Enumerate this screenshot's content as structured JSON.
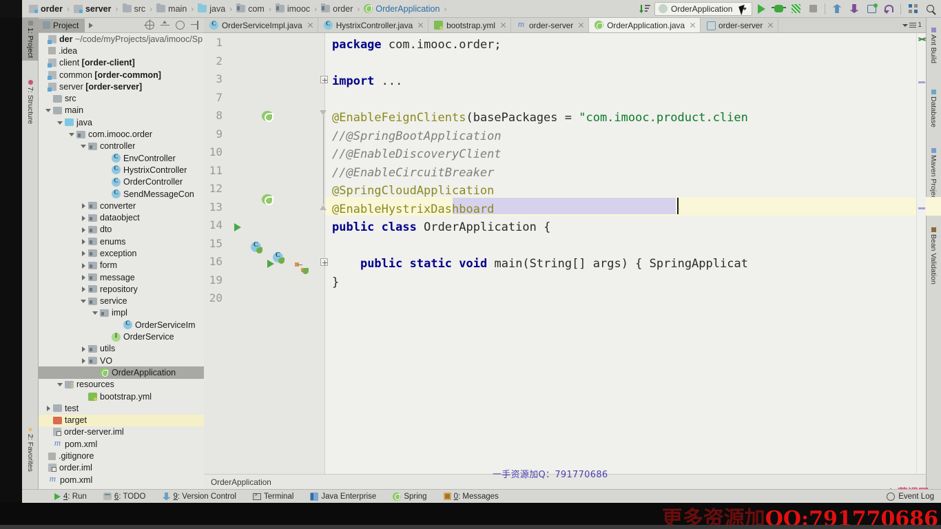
{
  "breadcrumb": {
    "items": [
      {
        "label": "order",
        "icon": "module-icon",
        "bold": true
      },
      {
        "label": "server",
        "icon": "module-icon",
        "bold": true
      },
      {
        "label": "src",
        "icon": "folder-icon",
        "bold": false
      },
      {
        "label": "main",
        "icon": "folder-icon",
        "bold": false
      },
      {
        "label": "java",
        "icon": "source-folder-icon",
        "bold": false
      },
      {
        "label": "com",
        "icon": "package-icon",
        "bold": false
      },
      {
        "label": "imooc",
        "icon": "package-icon",
        "bold": false
      },
      {
        "label": "order",
        "icon": "package-icon",
        "bold": false
      },
      {
        "label": "OrderApplication",
        "icon": "spring-class-icon",
        "bold": false,
        "accent": true
      }
    ],
    "separator": "›"
  },
  "toolbar": {
    "sort_icon": "sort-icon",
    "run_config": {
      "label": "OrderApplication",
      "icon": "run-config-icon",
      "caret": "chevron-down-icon"
    },
    "buttons": [
      {
        "name": "run-button",
        "icon": "play-icon"
      },
      {
        "name": "debug-button",
        "icon": "bug-icon"
      },
      {
        "name": "run-with-coverage-button",
        "icon": "coverage-icon"
      },
      {
        "name": "stop-button",
        "icon": "stop-icon"
      },
      {
        "name": "update-project-button",
        "icon": "vcs-update-icon"
      },
      {
        "name": "commit-button",
        "icon": "vcs-commit-icon"
      },
      {
        "name": "show-history-button",
        "icon": "history-icon"
      },
      {
        "name": "rollback-button",
        "icon": "undo-icon"
      },
      {
        "name": "layout-button",
        "icon": "grid-icon"
      },
      {
        "name": "search-everywhere-button",
        "icon": "search-icon"
      }
    ]
  },
  "left_strip": [
    {
      "label": "1: Project",
      "icon": "project-icon",
      "active": true
    },
    {
      "label": "7: Structure",
      "icon": "structure-icon",
      "active": false
    },
    {
      "label": "2: Favorites",
      "icon": "star-icon",
      "active": false
    }
  ],
  "right_strip": [
    {
      "label": "Ant Build",
      "icon": "ant-icon"
    },
    {
      "label": "Database",
      "icon": "database-icon"
    },
    {
      "label": "Maven Projects",
      "icon": "maven-icon"
    },
    {
      "label": "Bean Validation",
      "icon": "bean-icon"
    }
  ],
  "project_panel": {
    "tab_label": "Project",
    "tools": [
      {
        "name": "scroll-from-source-button",
        "icon": "target-icon"
      },
      {
        "name": "collapse-all-button",
        "icon": "collapse-icon"
      },
      {
        "name": "settings-button",
        "icon": "gear-icon"
      },
      {
        "name": "hide-button",
        "icon": "hide-icon"
      }
    ],
    "tree": [
      {
        "indent": 0,
        "arrow": "none",
        "icon": "module-icon",
        "label": "der",
        "bold_part": "",
        "suffix": " ~/code/myProjects/java/imooc/Sp",
        "root": true
      },
      {
        "indent": 0,
        "arrow": "none",
        "icon": "idea-icon",
        "label": ".idea",
        "bold_part": ""
      },
      {
        "indent": 0,
        "arrow": "none",
        "icon": "module-icon",
        "label": "client ",
        "bold_part": "[order-client]"
      },
      {
        "indent": 0,
        "arrow": "none",
        "icon": "module-icon",
        "label": "common ",
        "bold_part": "[order-common]"
      },
      {
        "indent": 0,
        "arrow": "none",
        "icon": "module-icon",
        "label": "server ",
        "bold_part": "[order-server]"
      },
      {
        "indent": 1,
        "arrow": "none",
        "icon": "folder-icon",
        "label": "src",
        "bold_part": ""
      },
      {
        "indent": 1,
        "arrow": "open",
        "icon": "folder-icon",
        "label": "main",
        "bold_part": ""
      },
      {
        "indent": 2,
        "arrow": "open",
        "icon": "source-folder-icon",
        "label": "java",
        "bold_part": ""
      },
      {
        "indent": 3,
        "arrow": "open",
        "icon": "package-icon",
        "label": "com.imooc.order",
        "bold_part": ""
      },
      {
        "indent": 4,
        "arrow": "open",
        "icon": "package-icon",
        "label": "controller",
        "bold_part": ""
      },
      {
        "indent": 6,
        "arrow": "none",
        "icon": "class-icon",
        "label": "EnvController",
        "bold_part": ""
      },
      {
        "indent": 6,
        "arrow": "none",
        "icon": "class-icon",
        "label": "HystrixController",
        "bold_part": ""
      },
      {
        "indent": 6,
        "arrow": "none",
        "icon": "class-icon",
        "label": "OrderController",
        "bold_part": ""
      },
      {
        "indent": 6,
        "arrow": "none",
        "icon": "class-icon",
        "label": "SendMessageCon",
        "bold_part": ""
      },
      {
        "indent": 4,
        "arrow": "closed",
        "icon": "package-icon",
        "label": "converter",
        "bold_part": ""
      },
      {
        "indent": 4,
        "arrow": "closed",
        "icon": "package-icon",
        "label": "dataobject",
        "bold_part": ""
      },
      {
        "indent": 4,
        "arrow": "closed",
        "icon": "package-icon",
        "label": "dto",
        "bold_part": ""
      },
      {
        "indent": 4,
        "arrow": "closed",
        "icon": "package-icon",
        "label": "enums",
        "bold_part": ""
      },
      {
        "indent": 4,
        "arrow": "closed",
        "icon": "package-icon",
        "label": "exception",
        "bold_part": ""
      },
      {
        "indent": 4,
        "arrow": "closed",
        "icon": "package-icon",
        "label": "form",
        "bold_part": ""
      },
      {
        "indent": 4,
        "arrow": "closed",
        "icon": "package-icon",
        "label": "message",
        "bold_part": ""
      },
      {
        "indent": 4,
        "arrow": "closed",
        "icon": "package-icon",
        "label": "repository",
        "bold_part": ""
      },
      {
        "indent": 4,
        "arrow": "open",
        "icon": "package-icon",
        "label": "service",
        "bold_part": ""
      },
      {
        "indent": 5,
        "arrow": "open",
        "icon": "package-icon",
        "label": "impl",
        "bold_part": ""
      },
      {
        "indent": 7,
        "arrow": "none",
        "icon": "class-icon",
        "label": "OrderServiceIm",
        "bold_part": ""
      },
      {
        "indent": 6,
        "arrow": "none",
        "icon": "interface-icon",
        "label": "OrderService",
        "bold_part": ""
      },
      {
        "indent": 4,
        "arrow": "closed",
        "icon": "package-icon",
        "label": "utils",
        "bold_part": ""
      },
      {
        "indent": 4,
        "arrow": "closed",
        "icon": "package-icon",
        "label": "VO",
        "bold_part": ""
      },
      {
        "indent": 5,
        "arrow": "none",
        "icon": "spring-class-icon",
        "label": "OrderApplication",
        "bold_part": "",
        "selected": true
      },
      {
        "indent": 2,
        "arrow": "open",
        "icon": "resources-icon",
        "label": "resources",
        "bold_part": ""
      },
      {
        "indent": 4,
        "arrow": "none",
        "icon": "yaml-icon",
        "label": "bootstrap.yml",
        "bold_part": ""
      },
      {
        "indent": 1,
        "arrow": "closed",
        "icon": "folder-icon",
        "label": "test",
        "bold_part": ""
      },
      {
        "indent": 1,
        "arrow": "none",
        "icon": "target-folder-icon",
        "label": "target",
        "bold_part": "",
        "highlight": true
      },
      {
        "indent": 1,
        "arrow": "none",
        "icon": "iml-icon",
        "label": "order-server.iml",
        "bold_part": ""
      },
      {
        "indent": 1,
        "arrow": "none",
        "icon": "maven-icon",
        "label": "pom.xml",
        "bold_part": ""
      },
      {
        "indent": 0,
        "arrow": "none",
        "icon": "git-icon",
        "label": ".gitignore",
        "bold_part": ""
      },
      {
        "indent": 0,
        "arrow": "none",
        "icon": "iml-icon",
        "label": "order.iml",
        "bold_part": ""
      },
      {
        "indent": 0,
        "arrow": "none",
        "icon": "maven-icon",
        "label": "pom.xml",
        "bold_part": ""
      }
    ]
  },
  "editor_tabs": {
    "tabs": [
      {
        "label": "OrderServiceImpl.java",
        "icon": "class-icon",
        "active": false
      },
      {
        "label": "HystrixController.java",
        "icon": "class-icon",
        "active": false
      },
      {
        "label": "bootstrap.yml",
        "icon": "yaml-icon",
        "active": false
      },
      {
        "label": "order-server",
        "icon": "maven-icon",
        "active": false
      },
      {
        "label": "OrderApplication.java",
        "icon": "spring-class-icon",
        "active": true
      },
      {
        "label": "order-server",
        "icon": "run-config-icon",
        "active": false
      }
    ],
    "overflow_count": "1"
  },
  "code": {
    "line_numbers": [
      "1",
      "2",
      "3",
      "7",
      "8",
      "9",
      "10",
      "11",
      "12",
      "13",
      "14",
      "15",
      "16",
      "19",
      "20"
    ],
    "lines": [
      "package com.imooc.order;",
      "",
      "import ...",
      "",
      "@EnableFeignClients(basePackages = \"com.imooc.product.clien",
      "//@SpringBootApplication",
      "//@EnableDiscoveryClient",
      "//@EnableCircuitBreaker",
      "@SpringCloudApplication",
      "@EnableHystrixDashboard",
      "public class OrderApplication {",
      "",
      "    public static void main(String[] args) { SpringApplicat",
      "}",
      ""
    ],
    "caret_line": "13",
    "selection_text": "@EnableHystrixDashboard"
  },
  "editor_footer": {
    "breadcrumb": "OrderApplication"
  },
  "status_bar": {
    "items": [
      {
        "label": "4: Run",
        "icon": "run-icon",
        "mnemonic": "4"
      },
      {
        "label": "6: TODO",
        "icon": "todo-icon",
        "mnemonic": "6"
      },
      {
        "label": "9: Version Control",
        "icon": "vcs-icon",
        "mnemonic": "9"
      },
      {
        "label": "Terminal",
        "icon": "terminal-icon",
        "mnemonic": ""
      },
      {
        "label": "Java Enterprise",
        "icon": "jee-icon",
        "mnemonic": ""
      },
      {
        "label": "Spring",
        "icon": "spring-icon",
        "mnemonic": ""
      },
      {
        "label": "0: Messages",
        "icon": "messages-icon",
        "mnemonic": "0"
      }
    ],
    "event_log": "Event Log"
  },
  "watermarks": {
    "center": "一手资源加Q：791770686",
    "logo": "慕课网",
    "bottom_cn": "更多资源加",
    "bottom_qq": "QQ:791770686"
  },
  "colors": {
    "chrome": "#d6d6d2",
    "editor_bg": "#f0f0ec",
    "tree_bg": "#e8e8e4",
    "selection": "#a8a8a4",
    "keyword": "#00008c",
    "annotation": "#8a8a1f",
    "comment": "#7f7f7f",
    "string": "#0a7a2a",
    "accent_green": "#3fae3f",
    "watermark_red": "#e01010"
  }
}
